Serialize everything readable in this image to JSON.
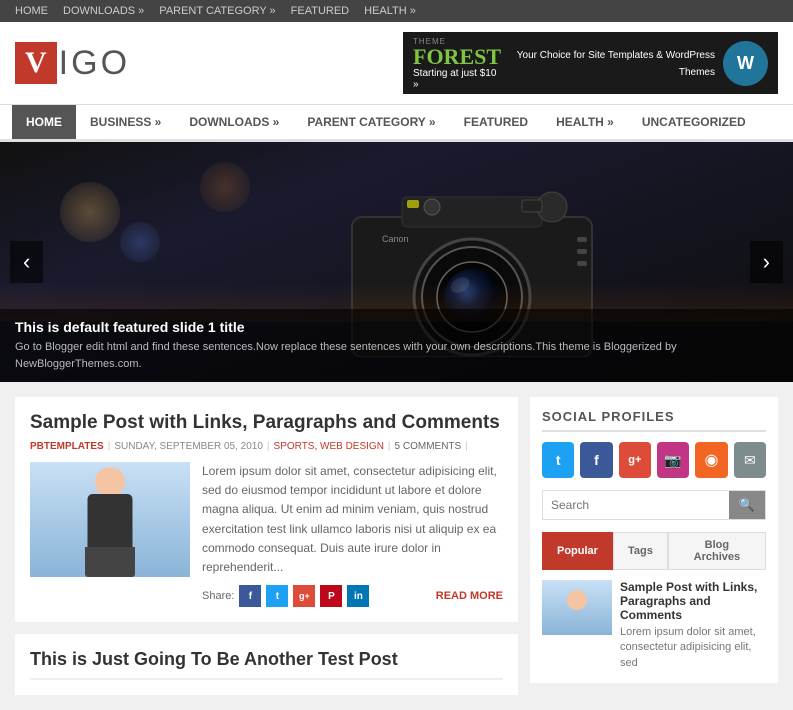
{
  "topnav": {
    "items": [
      {
        "label": "HOME",
        "url": "#"
      },
      {
        "label": "DOWNLOADS »",
        "url": "#"
      },
      {
        "label": "PARENT CATEGORY »",
        "url": "#"
      },
      {
        "label": "FEATURED",
        "url": "#"
      },
      {
        "label": "HEALTH »",
        "url": "#"
      }
    ]
  },
  "header": {
    "logo_v": "V",
    "logo_text": "IGO",
    "ad_theme_label": "THEME",
    "ad_forest_label": "FOREST",
    "ad_price": "Starting at just $10 »",
    "ad_tagline": "Your Choice for Site Templates & WordPress Themes"
  },
  "mainnav": {
    "items": [
      {
        "label": "HOME",
        "active": true
      },
      {
        "label": "BUSINESS »",
        "active": false
      },
      {
        "label": "DOWNLOADS »",
        "active": false
      },
      {
        "label": "PARENT CATEGORY »",
        "active": false
      },
      {
        "label": "FEATURED",
        "active": false
      },
      {
        "label": "HEALTH »",
        "active": false
      },
      {
        "label": "UNCATEGORIZED",
        "active": false
      }
    ]
  },
  "slider": {
    "prev_label": "‹",
    "next_label": "›",
    "title": "This is default featured slide 1 title",
    "description": "Go to Blogger edit html and find these sentences.Now replace these sentences with your own descriptions.This theme is Bloggerized by NewBloggerThemes.com."
  },
  "post1": {
    "title": "Sample Post with Links, Paragraphs and Comments",
    "meta_author": "PBTEMPLATES",
    "meta_date": "SUNDAY, SEPTEMBER 05, 2010",
    "meta_cats": "SPORTS, WEB DESIGN",
    "meta_comments": "5 COMMENTS",
    "body": "Lorem ipsum dolor sit amet, consectetur adipisicing elit, sed do eiusmod tempor incididunt ut labore et dolore magna aliqua. Ut enim ad minim veniam, quis nostrud exercitation test link ullamco laboris nisi ut aliquip ex ea commodo consequat. Duis aute irure dolor in reprehenderit...",
    "share_label": "Share:",
    "read_more": "READ MORE"
  },
  "post2": {
    "title": "This is Just Going To Be Another Test Post"
  },
  "sidebar": {
    "social_title": "SOCIAL PROFILES",
    "social_icons": [
      {
        "name": "twitter",
        "symbol": "🐦"
      },
      {
        "name": "facebook",
        "symbol": "f"
      },
      {
        "name": "google-plus",
        "symbol": "g+"
      },
      {
        "name": "instagram",
        "symbol": "📷"
      },
      {
        "name": "rss",
        "symbol": "◉"
      },
      {
        "name": "email",
        "symbol": "✉"
      }
    ],
    "search_placeholder": "Search",
    "tabs": [
      {
        "label": "Popular",
        "active": true
      },
      {
        "label": "Tags",
        "active": false
      },
      {
        "label": "Blog Archives",
        "active": false
      }
    ],
    "popular_post": {
      "title": "Sample Post with Links, Paragraphs and Comments",
      "excerpt": "Lorem ipsum dolor sit amet, consectetur adipisicing elit, sed"
    }
  }
}
